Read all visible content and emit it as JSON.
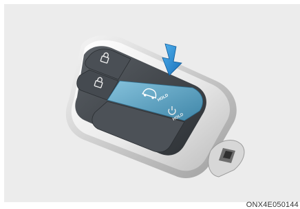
{
  "figure": {
    "caption_code": "ONX4E050144",
    "button_labels": {
      "lock": "",
      "unlock": "",
      "remote_start": "HOLD",
      "trunk": "HOLD"
    },
    "highlighted_button": "remote_start",
    "colors": {
      "background": "#ececec",
      "fob_body": "#f4f4f4",
      "button_panel": "#3a3f44",
      "highlight": "#5aa6c8",
      "arrow": "#2a8ad2"
    },
    "icons": [
      "lock-icon",
      "unlock-icon",
      "remote-start-car-icon",
      "power-icon",
      "down-arrow-icon"
    ]
  }
}
